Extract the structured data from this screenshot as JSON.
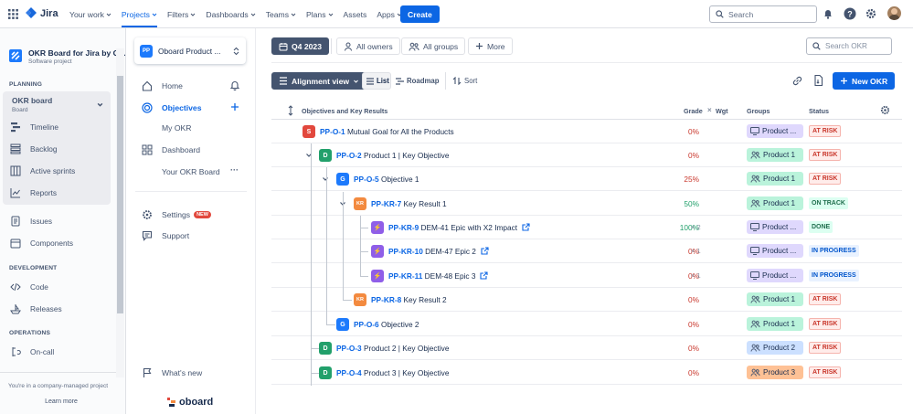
{
  "topbar": {
    "product": "Jira",
    "nav": [
      {
        "label": "Your work",
        "active": false
      },
      {
        "label": "Projects",
        "active": true
      },
      {
        "label": "Filters",
        "active": false
      },
      {
        "label": "Dashboards",
        "active": false
      },
      {
        "label": "Teams",
        "active": false
      },
      {
        "label": "Plans",
        "active": false
      },
      {
        "label": "Assets",
        "active": false
      },
      {
        "label": "Apps",
        "active": false
      }
    ],
    "create_label": "Create",
    "search_placeholder": "Search"
  },
  "left_sidebar": {
    "project_name": "OKR Board for Jira by O...",
    "project_type": "Software project",
    "planning_heading": "PLANNING",
    "board_name": "OKR board",
    "board_type": "Board",
    "planning_items": [
      "Timeline",
      "Backlog",
      "Active sprints",
      "Reports"
    ],
    "other_items": [
      "Issues",
      "Components"
    ],
    "development_heading": "DEVELOPMENT",
    "development_items": [
      "Code",
      "Releases"
    ],
    "operations_heading": "OPERATIONS",
    "operations_items": [
      "On-call"
    ],
    "footer_text": "You're in a company-managed project",
    "learn_more": "Learn more"
  },
  "app_sidebar": {
    "product_selector": "Oboard Product ...",
    "items": {
      "home": "Home",
      "objectives": "Objectives",
      "my_okr": "My OKR",
      "dashboard": "Dashboard",
      "your_okr_board": "Your OKR Board",
      "settings": "Settings",
      "settings_badge": "NEW",
      "support": "Support",
      "whats_new": "What's new"
    },
    "brand": "oboard"
  },
  "toolbar": {
    "period": "Q4 2023",
    "all_owners": "All owners",
    "all_groups": "All groups",
    "more": "More",
    "search_placeholder": "Search OKR",
    "view": "Alignment view",
    "list": "List",
    "roadmap": "Roadmap",
    "sort": "Sort",
    "new_okr": "New OKR"
  },
  "table": {
    "headers": {
      "objective": "Objectives and Key Results",
      "grade": "Grade",
      "weight": "Wgt",
      "groups": "Groups",
      "status": "Status"
    },
    "rows": [
      {
        "badge": "S",
        "badge_color": "#e2483d",
        "key": "PP-O-1",
        "title": "Mutual Goal for All the Products",
        "grade": "0%",
        "grade_color": "#c9372c",
        "weight": "",
        "group": "Product ...",
        "group_color": "#dfd8fd",
        "group_icon": "monitor-icon",
        "status": "AT RISK",
        "status_type": "risk"
      },
      {
        "badge": "D",
        "badge_color": "#22a06b",
        "key": "PP-O-2",
        "title": "Product 1 | Key Objective",
        "grade": "0%",
        "grade_color": "#c9372c",
        "weight": "",
        "group": "Product 1",
        "group_color": "#baf3db",
        "group_icon": "people-icon",
        "status": "AT RISK",
        "status_type": "risk"
      },
      {
        "badge": "G",
        "badge_color": "#1d7afc",
        "key": "PP-O-5",
        "title": "Objective 1",
        "grade": "25%",
        "grade_color": "#c9372c",
        "weight": "",
        "group": "Product 1",
        "group_color": "#baf3db",
        "group_icon": "people-icon",
        "status": "AT RISK",
        "status_type": "risk"
      },
      {
        "badge": "KR",
        "badge_color": "#f38a3f",
        "key": "PP-KR-7",
        "title": "Key Result 1",
        "grade": "50%",
        "grade_color": "#22a06b",
        "weight": "",
        "group": "Product 1",
        "group_color": "#baf3db",
        "group_icon": "people-icon",
        "status": "ON TRACK",
        "status_type": "track"
      },
      {
        "badge": "⚡",
        "badge_color": "#8f5ee8",
        "key": "PP-KR-9",
        "title": "DEM-41 Epic with X2 Impact",
        "grade": "100%",
        "grade_color": "#22a06b",
        "weight": "2",
        "group": "Product ...",
        "group_color": "#dfd8fd",
        "group_icon": "monitor-icon",
        "status": "DONE",
        "status_type": "done"
      },
      {
        "badge": "⚡",
        "badge_color": "#8f5ee8",
        "key": "PP-KR-10",
        "title": "DEM-47 Epic 2",
        "grade": "0%",
        "grade_color": "#c9372c",
        "weight": "1",
        "group": "Product ...",
        "group_color": "#dfd8fd",
        "group_icon": "monitor-icon",
        "status": "IN PROGRESS",
        "status_type": "prog"
      },
      {
        "badge": "⚡",
        "badge_color": "#8f5ee8",
        "key": "PP-KR-11",
        "title": "DEM-48 Epic 3",
        "grade": "0%",
        "grade_color": "#c9372c",
        "weight": "1",
        "group": "Product ...",
        "group_color": "#dfd8fd",
        "group_icon": "monitor-icon",
        "status": "IN PROGRESS",
        "status_type": "prog"
      },
      {
        "badge": "KR",
        "badge_color": "#f38a3f",
        "key": "PP-KR-8",
        "title": "Key Result 2",
        "grade": "0%",
        "grade_color": "#c9372c",
        "weight": "",
        "group": "Product 1",
        "group_color": "#baf3db",
        "group_icon": "people-icon",
        "status": "AT RISK",
        "status_type": "risk"
      },
      {
        "badge": "G",
        "badge_color": "#1d7afc",
        "key": "PP-O-6",
        "title": "Objective 2",
        "grade": "0%",
        "grade_color": "#c9372c",
        "weight": "",
        "group": "Product 1",
        "group_color": "#baf3db",
        "group_icon": "people-icon",
        "status": "AT RISK",
        "status_type": "risk"
      },
      {
        "badge": "D",
        "badge_color": "#22a06b",
        "key": "PP-O-3",
        "title": "Product 2 | Key Objective",
        "grade": "0%",
        "grade_color": "#c9372c",
        "weight": "",
        "group": "Product 2",
        "group_color": "#cce0ff",
        "group_icon": "people-icon",
        "status": "AT RISK",
        "status_type": "risk"
      },
      {
        "badge": "D",
        "badge_color": "#22a06b",
        "key": "PP-O-4",
        "title": "Product 3 | Key Objective",
        "grade": "0%",
        "grade_color": "#c9372c",
        "weight": "",
        "group": "Product 3",
        "group_color": "#fec195",
        "group_icon": "people-icon",
        "status": "AT RISK",
        "status_type": "risk"
      }
    ]
  }
}
